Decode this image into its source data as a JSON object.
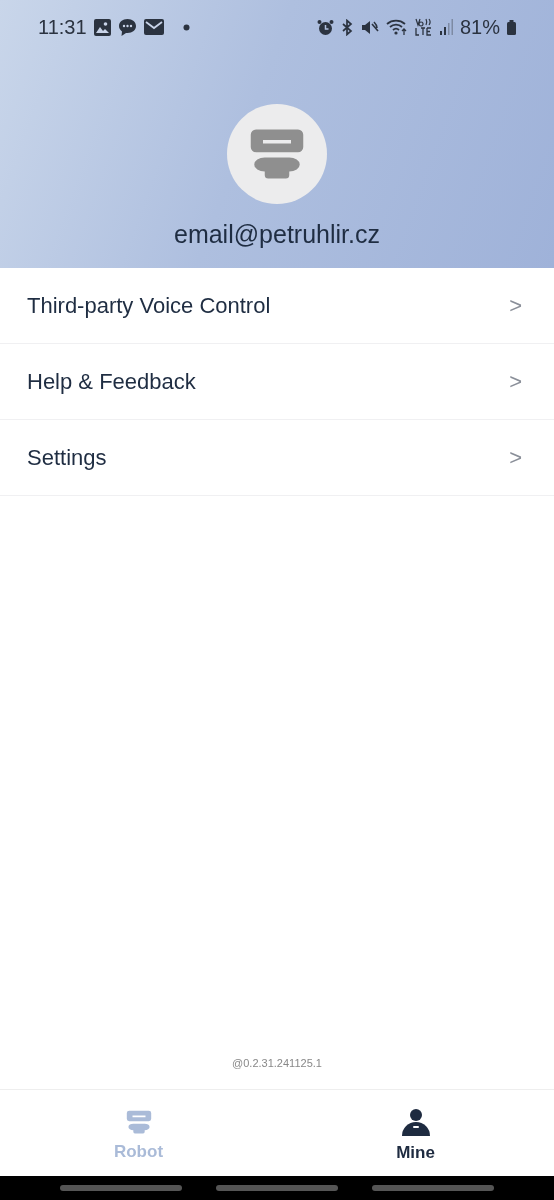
{
  "status_bar": {
    "time": "11:31",
    "battery": "81%"
  },
  "profile": {
    "email": "email@petruhlir.cz"
  },
  "menu": [
    {
      "label": "Third-party Voice Control",
      "arrow": ">"
    },
    {
      "label": "Help & Feedback",
      "arrow": ">"
    },
    {
      "label": "Settings",
      "arrow": ">"
    }
  ],
  "version": "@0.2.31.241125.1",
  "tabs": [
    {
      "label": "Robot",
      "kind": "robot",
      "selected": false
    },
    {
      "label": "Mine",
      "kind": "person",
      "selected": true
    }
  ]
}
